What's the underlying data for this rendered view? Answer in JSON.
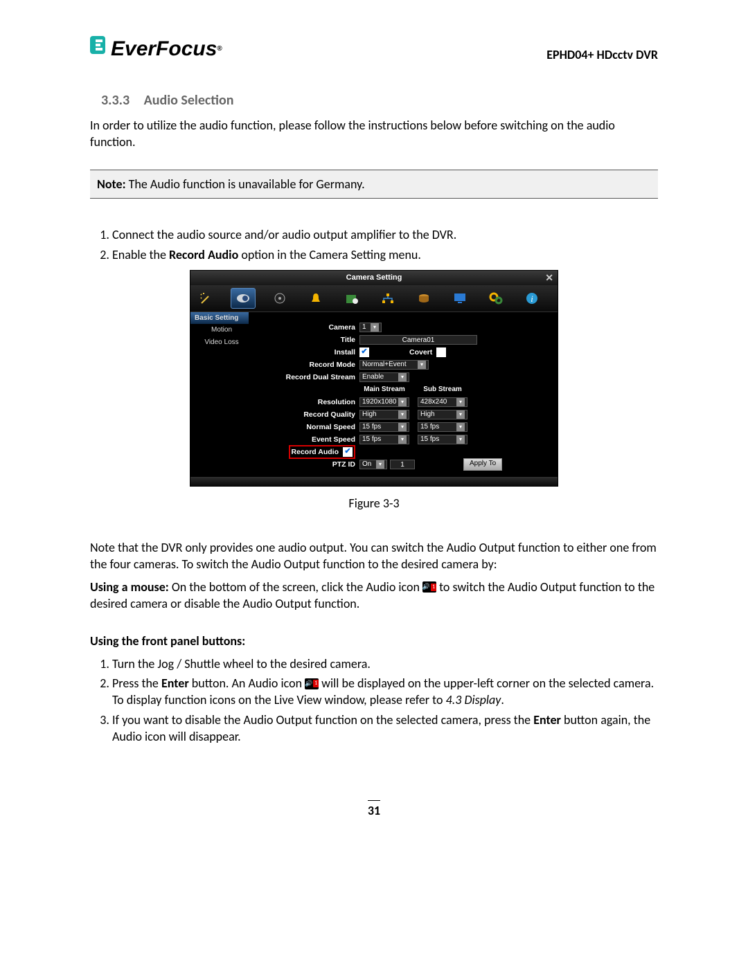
{
  "header": {
    "brand": "EverFocus",
    "model": "EPHD04+  HDcctv DVR"
  },
  "section": {
    "number": "3.3.3",
    "title": "Audio Selection"
  },
  "intro": "In order to utilize the audio function, please follow the instructions below before switching on the audio function.",
  "note_label": "Note:",
  "note_text": " The Audio function is unavailable for Germany.",
  "steps_top": {
    "1": "Connect the audio source and/or audio output amplifier to the DVR.",
    "2_a": "Enable the ",
    "2_b": "Record Audio",
    "2_c": " option in the Camera Setting menu."
  },
  "figure_caption": "Figure 3-3",
  "dvr": {
    "title": "Camera Setting",
    "side": {
      "basic": "Basic Setting",
      "motion": "Motion",
      "videoloss": "Video Loss"
    },
    "labels": {
      "camera": "Camera",
      "title": "Title",
      "install": "Install",
      "covert": "Covert",
      "record_mode": "Record Mode",
      "dual_stream": "Record Dual Stream",
      "main_stream": "Main Stream",
      "sub_stream": "Sub Stream",
      "resolution": "Resolution",
      "quality": "Record Quality",
      "normal_speed": "Normal Speed",
      "event_speed": "Event Speed",
      "record_audio": "Record Audio",
      "ptz_id": "PTZ ID",
      "apply_to": "Apply To"
    },
    "values": {
      "camera": "1",
      "title": "Camera01",
      "record_mode": "Normal+Event",
      "dual_stream": "Enable",
      "res_main": "1920x1080",
      "res_sub": "428x240",
      "quality_main": "High",
      "quality_sub": "High",
      "nspeed_main": "15 fps",
      "nspeed_sub": "15 fps",
      "espeed_main": "15 fps",
      "espeed_sub": "15 fps",
      "ptz_on": "On",
      "ptz_num": "1"
    }
  },
  "para_after_fig": "Note that the DVR only provides one audio output. You can switch the Audio Output function to either one from the four cameras.  To switch the Audio Output function to the desired camera by:",
  "mouse": {
    "label": "Using a mouse:",
    "before_icon": " On the bottom of the screen, click the Audio icon ",
    "after_icon": " to switch the Audio Output function to the desired camera or disable the Audio Output function."
  },
  "front_panel_heading": "Using the front panel buttons:",
  "fp_steps": {
    "1": "Turn the Jog / Shuttle wheel to the desired camera.",
    "2_a": "Press the ",
    "2_b": "Enter",
    "2_c": " button. An Audio icon ",
    "2_d": " will be displayed on the upper-left corner on the selected camera. To display function icons on the Live View window, please refer to ",
    "2_e": "4.3 Display",
    "2_f": ".",
    "3_a": "If you want to disable the Audio Output function on the selected camera, press the ",
    "3_b": "Enter",
    "3_c": " button again, the Audio icon will disappear."
  },
  "page_number": "31"
}
